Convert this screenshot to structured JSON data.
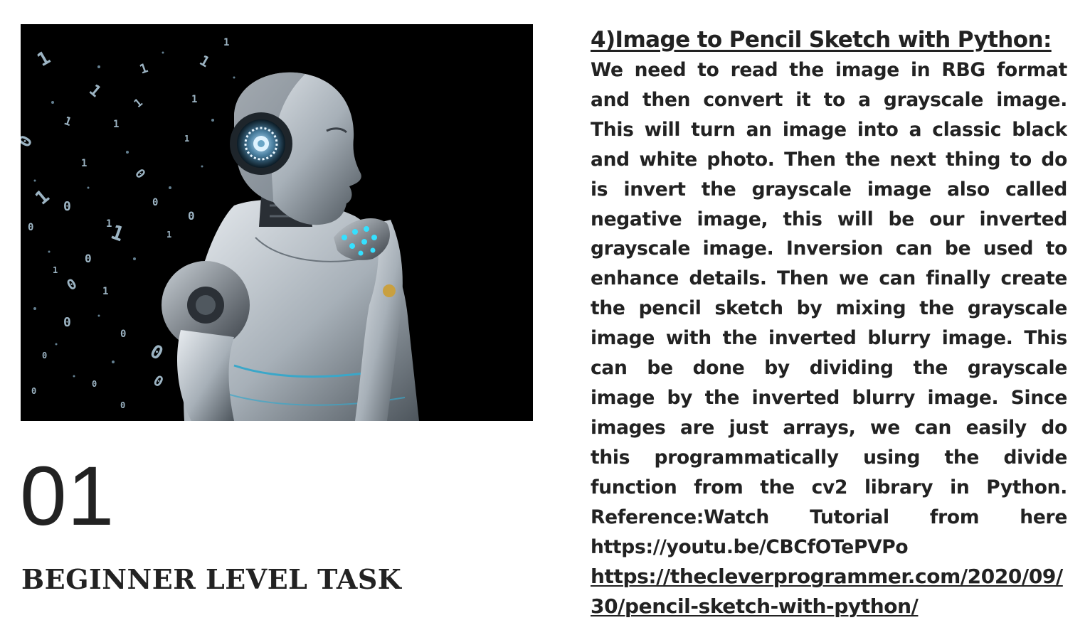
{
  "task": {
    "number": "01",
    "level": "BEGINNER LEVEL TASK"
  },
  "project": {
    "heading": "4)Image to Pencil Sketch with Python:",
    "description_lines": [
      "We need to read the image in RBG format",
      "and then convert it to a grayscale image.",
      "This will turn an image into a classic black",
      "and white photo. Then the next thing to do",
      "is invert the grayscale image also called",
      "negative image, this will be our inverted",
      "grayscale image. Inversion can be used to",
      "enhance details. Then we can finally create",
      "the pencil sketch by mixing the grayscale",
      "image with the inverted blurry image. This",
      "can be done by dividing the grayscale",
      "image by the inverted blurry image. Since",
      "images are just arrays, we can easily do",
      "this programmatically using the divide",
      "function from the cv2 library in Python.",
      "Reference:Watch Tutorial from here",
      "https://youtu.be/CBCfOTePVPo"
    ],
    "article_link": "https://thecleverprogrammer.com/2020/09/30/pencil-sketch-with-python/"
  },
  "hero_image": {
    "icon": "thinking-robot-binary-image"
  },
  "colors": {
    "text": "#222222",
    "image_background": "#000000"
  }
}
